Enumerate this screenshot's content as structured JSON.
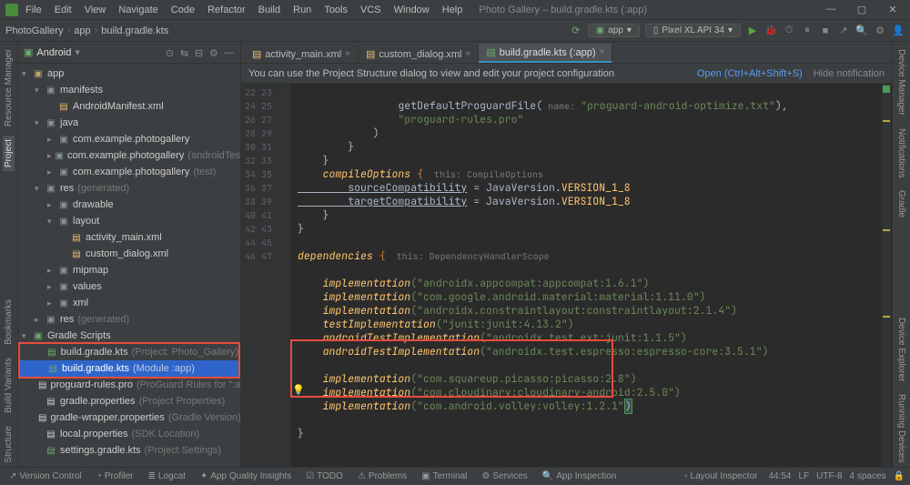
{
  "menu": [
    "File",
    "Edit",
    "View",
    "Navigate",
    "Code",
    "Refactor",
    "Build",
    "Run",
    "Tools",
    "VCS",
    "Window",
    "Help"
  ],
  "window_title": "Photo Gallery – build.gradle.kts (:app)",
  "breadcrumb": [
    "PhotoGallery",
    "app",
    "build.gradle.kts"
  ],
  "run_config_app": "app",
  "run_config_device": "Pixel XL API 34",
  "project_header": "Android",
  "tree": {
    "app": "app",
    "manifests": "manifests",
    "manifest_file": "AndroidManifest.xml",
    "java": "java",
    "pkg1": "com.example.photogallery",
    "pkg2": "com.example.photogallery",
    "pkg2_suffix": "(androidTest)",
    "pkg3": "com.example.photogallery",
    "pkg3_suffix": "(test)",
    "res": "res",
    "res_suffix": "(generated)",
    "drawable": "drawable",
    "layout": "layout",
    "layout1": "activity_main.xml",
    "layout2": "custom_dialog.xml",
    "mipmap": "mipmap",
    "values": "values",
    "xml": "xml",
    "res_gen": "res",
    "res_gen_suffix": "(generated)",
    "gradle_scripts": "Gradle Scripts",
    "bg1": "build.gradle.kts",
    "bg1_suffix": "(Project: Photo_Gallery)",
    "bg2": "build.gradle.kts",
    "bg2_suffix": "(Module :app)",
    "pg_rules": "proguard-rules.pro",
    "pg_rules_suffix": "(ProGuard Rules for \":app\")",
    "gp": "gradle.properties",
    "gp_suffix": "(Project Properties)",
    "gwp": "gradle-wrapper.properties",
    "gwp_suffix": "(Gradle Version)",
    "lp": "local.properties",
    "lp_suffix": "(SDK Location)",
    "sg": "settings.gradle.kts",
    "sg_suffix": "(Project Settings)"
  },
  "editor_tabs": [
    {
      "icon": "xml",
      "label": "activity_main.xml",
      "active": false
    },
    {
      "icon": "xml",
      "label": "custom_dialog.xml",
      "active": false
    },
    {
      "icon": "gradle",
      "label": "build.gradle.kts (:app)",
      "active": true
    }
  ],
  "banner_text": "You can use the Project Structure dialog to view and edit your project configuration",
  "banner_open": "Open (Ctrl+Alt+Shift+S)",
  "banner_hide": "Hide notification",
  "line_start": 22,
  "line_end": 47,
  "code": {
    "l22a": "                getDefaultProguardFile(",
    "l22b": " name: ",
    "l22c": "\"proguard-android-optimize.txt\"",
    "l22d": "),",
    "l23": "                \"proguard-rules.pro\"",
    "l24": "            )",
    "l25": "        }",
    "l26": "    }",
    "l27": "    compileOptions {",
    "l27h": "  this: CompileOptions",
    "l28a": "        sourceCompatibility",
    "l28b": " = JavaVersion.",
    "l28c": "VERSION_1_8",
    "l29a": "        targetCompatibility",
    "l29b": " = JavaVersion.",
    "l29c": "VERSION_1_8",
    "l30": "    }",
    "l31": "}",
    "l33a": "dependencies",
    "l33b": " {",
    "l33h": "  this: DependencyHandlerScope",
    "l35a": "    implementation",
    "l35b": "(\"androidx.appcompat:appcompat:1.6.1\")",
    "l36a": "    implementation",
    "l36b": "(\"com.google.android.material:material:1.11.0\")",
    "l37a": "    implementation",
    "l37b": "(\"androidx.constraintlayout:constraintlayout:2.1.4\")",
    "l38a": "    testImplementation",
    "l38b": "(\"junit:junit:4.13.2\")",
    "l39a": "    androidTestImplementation",
    "l39b": "(\"androidx.test.ext:junit:1.1.5\")",
    "l40a": "    androidTestImplementation",
    "l40b": "(\"androidx.test.espresso:espresso-core:3.5.1\")",
    "l42a": "    implementation",
    "l42b": "(\"com.squareup.picasso:picasso:2.8\")",
    "l43a": "    implementation",
    "l43b": "(\"com.cloudinary:cloudinary-android:2.5.0\")",
    "l44a": "    implementation",
    "l44b": "(\"com.android.volley:volley:1.2.1\"",
    "l44c": ")",
    "l46": "}"
  },
  "bottom_tabs": [
    "Version Control",
    "Profiler",
    "Logcat",
    "App Quality Insights",
    "TODO",
    "Problems",
    "Terminal",
    "Services",
    "App Inspection"
  ],
  "bottom_right": "Layout Inspector",
  "status": {
    "pos": "44:54",
    "le": "LF",
    "enc": "UTF-8",
    "indent": "4 spaces"
  },
  "left_vtabs": [
    "Resource Manager",
    "Project",
    "Bookmarks",
    "Build Variants",
    "Structure"
  ],
  "right_vtabs": [
    "Device Manager",
    "Notifications",
    "Gradle",
    "Device Explorer",
    "Running Devices"
  ]
}
